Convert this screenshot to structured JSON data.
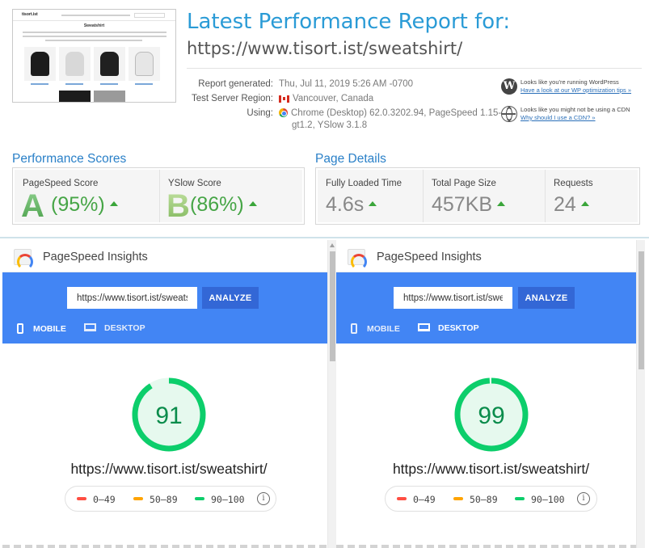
{
  "report": {
    "title": "Latest Performance Report for:",
    "url": "https://www.tisort.ist/sweatshirt/",
    "meta": [
      {
        "label": "Report generated:",
        "value": "Thu, Jul 11, 2019 5:26 AM -0700"
      },
      {
        "label": "Test Server Region:",
        "value": "Vancouver, Canada"
      },
      {
        "label": "Using:",
        "value": "Chrome (Desktop) 62.0.3202.94, PageSpeed 1.15-",
        "value2": "gt1.2, YSlow 3.1.8"
      }
    ],
    "notes": [
      {
        "icon": "wordpress-icon",
        "text": "Looks like you're running WordPress",
        "link": "Have a look at our WP optimization tips »"
      },
      {
        "icon": "globe-icon",
        "text": "Looks like you might not be using a CDN",
        "link": "Why should I use a CDN? »"
      }
    ]
  },
  "thumbnail": {
    "logo": "tisort.ist",
    "heading": "Sweatshirt",
    "shirt_colors": [
      "#1c1c1c",
      "#d8d8d8",
      "#202020",
      "#e6e6e6"
    ]
  },
  "performance": {
    "title": "Performance Scores",
    "pagespeed": {
      "label": "PageSpeed Score",
      "grade": "A",
      "percent": "(95%)"
    },
    "yslow": {
      "label": "YSlow Score",
      "grade": "B",
      "percent": "(86%)"
    }
  },
  "details": {
    "title": "Page Details",
    "loaded": {
      "label": "Fully Loaded Time",
      "value": "4.6s"
    },
    "size": {
      "label": "Total Page Size",
      "value": "457KB"
    },
    "requests": {
      "label": "Requests",
      "value": "24"
    }
  },
  "panes": [
    {
      "brand": "PageSpeed Insights",
      "input_value": "https://www.tisort.ist/sweatshirt/",
      "analyze": "ANALYZE",
      "tab_mobile": "MOBILE",
      "tab_desktop": "DESKTOP",
      "active_tab": "mobile",
      "score": "91",
      "score_value": 91,
      "url": "https://www.tisort.ist/sweatshirt/",
      "legend": [
        "0–49",
        "50–89",
        "90–100"
      ]
    },
    {
      "brand": "PageSpeed Insights",
      "input_value": "https://www.tisort.ist/sweatshirt/",
      "analyze": "ANALYZE",
      "tab_mobile": "MOBILE",
      "tab_desktop": "DESKTOP",
      "active_tab": "desktop",
      "score": "99",
      "score_value": 99,
      "url": "https://www.tisort.ist/sweatshirt/",
      "legend": [
        "0–49",
        "50–89",
        "90–100"
      ]
    }
  ],
  "colors": {
    "accent_blue": "#2a9bd6",
    "psi_blue": "#4285f4",
    "score_green": "#0cce6b",
    "legend_red": "#ff4e42",
    "legend_orange": "#ffa400",
    "legend_green": "#0cce6b"
  }
}
